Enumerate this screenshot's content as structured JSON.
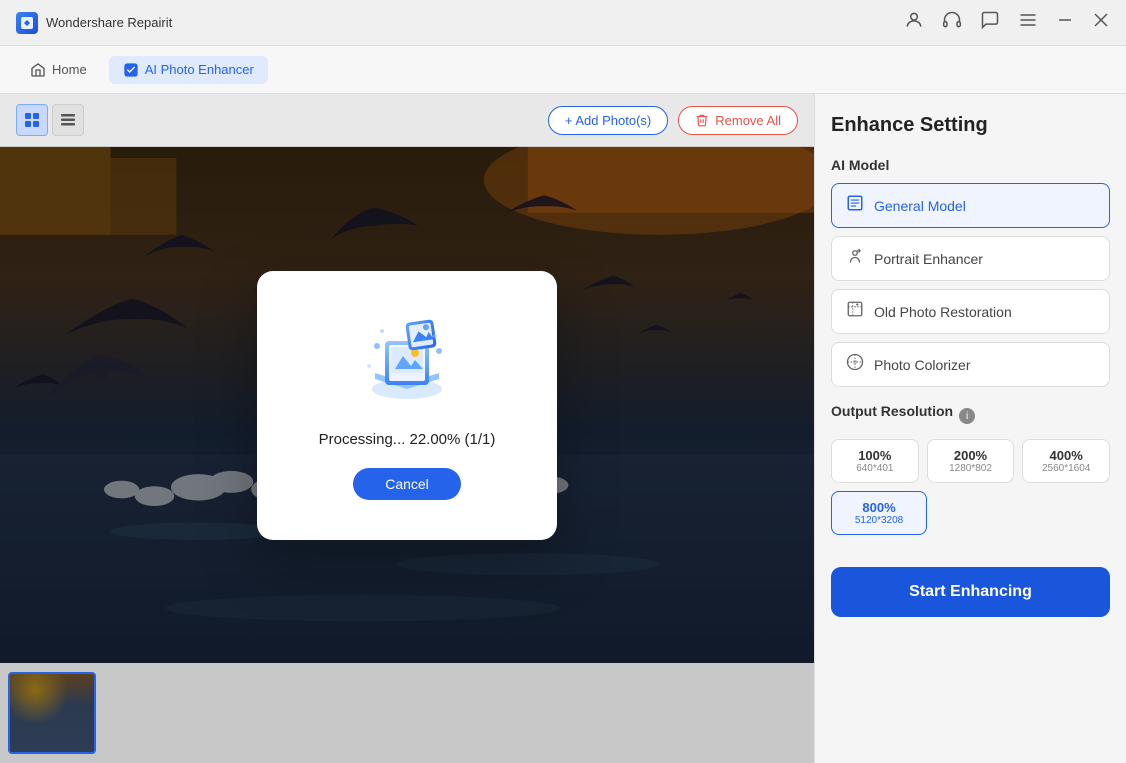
{
  "titleBar": {
    "appName": "Wondershare Repairit",
    "icons": {
      "account": "👤",
      "headphones": "🎧",
      "chat": "💬",
      "menu": "☰",
      "minimize": "—",
      "close": "✕"
    }
  },
  "nav": {
    "homeTab": "Home",
    "activeTab": "AI Photo Enhancer"
  },
  "toolbar": {
    "addPhotos": "+ Add Photo(s)",
    "removeAll": "Remove All"
  },
  "modal": {
    "processingText": "Processing... 22.00% (1/1)",
    "cancelBtn": "Cancel"
  },
  "rightPanel": {
    "title": "Enhance Setting",
    "aiModelLabel": "AI Model",
    "models": [
      {
        "id": "general",
        "label": "General Model",
        "selected": true
      },
      {
        "id": "portrait",
        "label": "Portrait Enhancer",
        "selected": false
      },
      {
        "id": "oldphoto",
        "label": "Old Photo Restoration",
        "selected": false
      },
      {
        "id": "colorizer",
        "label": "Photo Colorizer",
        "selected": false
      }
    ],
    "outputResLabel": "Output Resolution",
    "resolutions": [
      {
        "pct": "100%",
        "dim": "640*401",
        "selected": false
      },
      {
        "pct": "200%",
        "dim": "1280*802",
        "selected": false
      },
      {
        "pct": "400%",
        "dim": "2560*1604",
        "selected": false
      },
      {
        "pct": "800%",
        "dim": "5120*3208",
        "selected": true
      }
    ],
    "startBtn": "Start Enhancing"
  }
}
